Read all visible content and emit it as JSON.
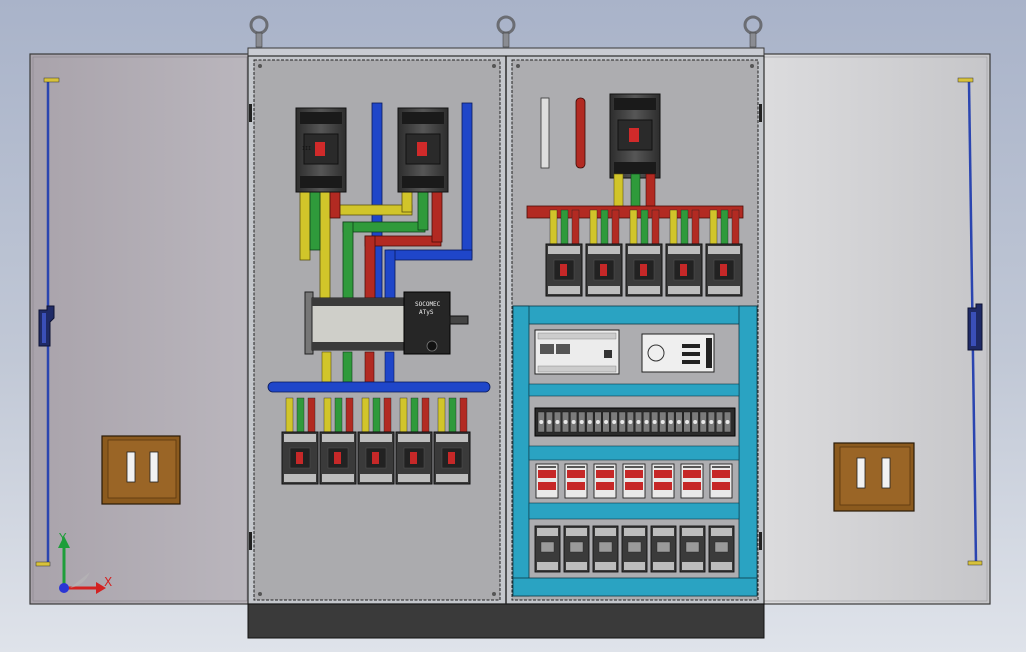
{
  "view": {
    "background_top": "#a9b3c9",
    "background_bottom": "#dfe3ea"
  },
  "cabinet": {
    "left_door_color": "#b2adb4",
    "right_door_color": "#cfcfd2",
    "frame_color": "#c4c7cc",
    "mounting_plate_color": "#ababae",
    "base_color": "#3a3a3a",
    "lifting_eyes": 3,
    "door_handle_icon": "door-handle-icon",
    "door_lock_rod_color": "#2b45b0",
    "nameplate_color": "#8b5a1e"
  },
  "busbar_colors": {
    "L1": "#d1c52a",
    "L2": "#2f9a3b",
    "L3": "#b22a22",
    "N": "#1f46c9"
  },
  "left_panel": {
    "main_breakers": 2,
    "transfer_switch": {
      "label_line1": "SOCOMEC",
      "label_line2": "ATyS"
    },
    "outgoing_breakers": 5
  },
  "right_panel": {
    "incoming_breaker": 1,
    "outgoing_breakers": 5,
    "terminal_blocks": 24,
    "relays": 7,
    "contactors": 7,
    "duct_color": "#2aa3c2"
  },
  "axis_triad": {
    "x_label": "X",
    "y_label": "Y"
  }
}
